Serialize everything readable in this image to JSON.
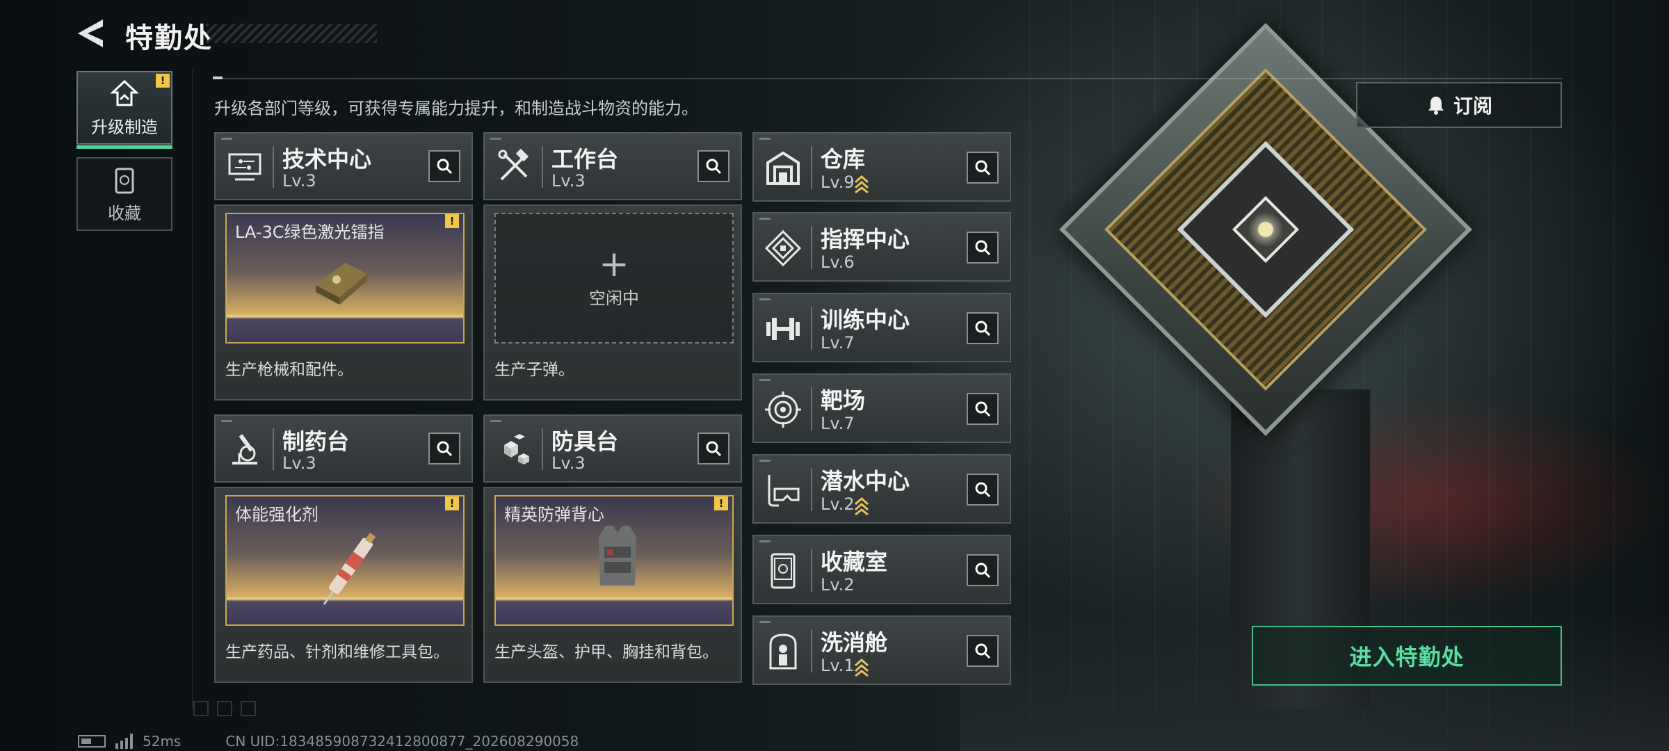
{
  "header": {
    "title": "特勤处"
  },
  "nav": [
    {
      "label": "升级制造",
      "icon": "upgrade-icon",
      "active": true,
      "alert": "!"
    },
    {
      "label": "收藏",
      "icon": "collection-icon",
      "active": false
    }
  ],
  "description": "升级各部门等级，可获得专属能力提升，和制造战斗物资的能力。",
  "subscribe": {
    "label": "订阅",
    "icon": "bell-icon"
  },
  "production_departments": [
    {
      "name": "技术中心",
      "level": "Lv.3",
      "icon": "tech-center-icon",
      "slot": {
        "status": "producing",
        "item": "LA-3C绿色激光镭指",
        "alert": "!"
      },
      "description": "生产枪械和配件。"
    },
    {
      "name": "工作台",
      "level": "Lv.3",
      "icon": "workbench-icon",
      "slot": {
        "status": "idle",
        "plus": "+",
        "idle_label": "空闲中"
      },
      "description": "生产子弹。"
    },
    {
      "name": "制药台",
      "level": "Lv.3",
      "icon": "pharmacy-icon",
      "slot": {
        "status": "producing",
        "item": "体能强化剂",
        "alert": "!"
      },
      "description": "生产药品、针剂和维修工具包。"
    },
    {
      "name": "防具台",
      "level": "Lv.3",
      "icon": "armor-bench-icon",
      "slot": {
        "status": "producing",
        "item": "精英防弹背心",
        "alert": "!"
      },
      "description": "生产头盔、护甲、胸挂和背包。"
    }
  ],
  "other_departments": [
    {
      "name": "仓库",
      "level": "Lv.9",
      "icon": "warehouse-icon",
      "upgradable": true
    },
    {
      "name": "指挥中心",
      "level": "Lv.6",
      "icon": "command-center-icon",
      "upgradable": false
    },
    {
      "name": "训练中心",
      "level": "Lv.7",
      "icon": "dumbbell-icon",
      "upgradable": false
    },
    {
      "name": "靶场",
      "level": "Lv.7",
      "icon": "target-icon",
      "upgradable": false
    },
    {
      "name": "潜水中心",
      "level": "Lv.2",
      "icon": "diving-mask-icon",
      "upgradable": true
    },
    {
      "name": "收藏室",
      "level": "Lv.2",
      "icon": "collection-room-icon",
      "upgradable": false
    },
    {
      "name": "洗消舱",
      "level": "Lv.1",
      "icon": "decontamination-icon",
      "upgradable": true
    }
  ],
  "enter": {
    "label": "进入特勤处"
  },
  "status_bar": {
    "ping": "52ms",
    "uid": "CN UID:18348590873241280087​7_202608290058"
  },
  "colors": {
    "accent_green": "#4fd39a",
    "gold": "#c9a64e",
    "alert_yellow": "#f0c846",
    "upgrade_arrow": "#e8c25a"
  }
}
